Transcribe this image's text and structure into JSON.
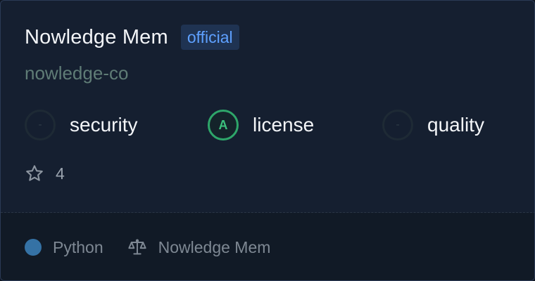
{
  "card": {
    "title": "Nowledge Mem",
    "badge": "official",
    "owner": "nowledge-co"
  },
  "scores": [
    {
      "label": "security",
      "grade": "-",
      "state": "empty"
    },
    {
      "label": "license",
      "grade": "A",
      "state": "grade-a"
    },
    {
      "label": "quality",
      "grade": "-",
      "state": "empty"
    }
  ],
  "stats": {
    "star_icon": "star-icon",
    "stars": "4"
  },
  "footer": {
    "language": "Python",
    "language_color": "#3572a5",
    "license_icon": "scale-icon",
    "license": "Nowledge Mem"
  }
}
